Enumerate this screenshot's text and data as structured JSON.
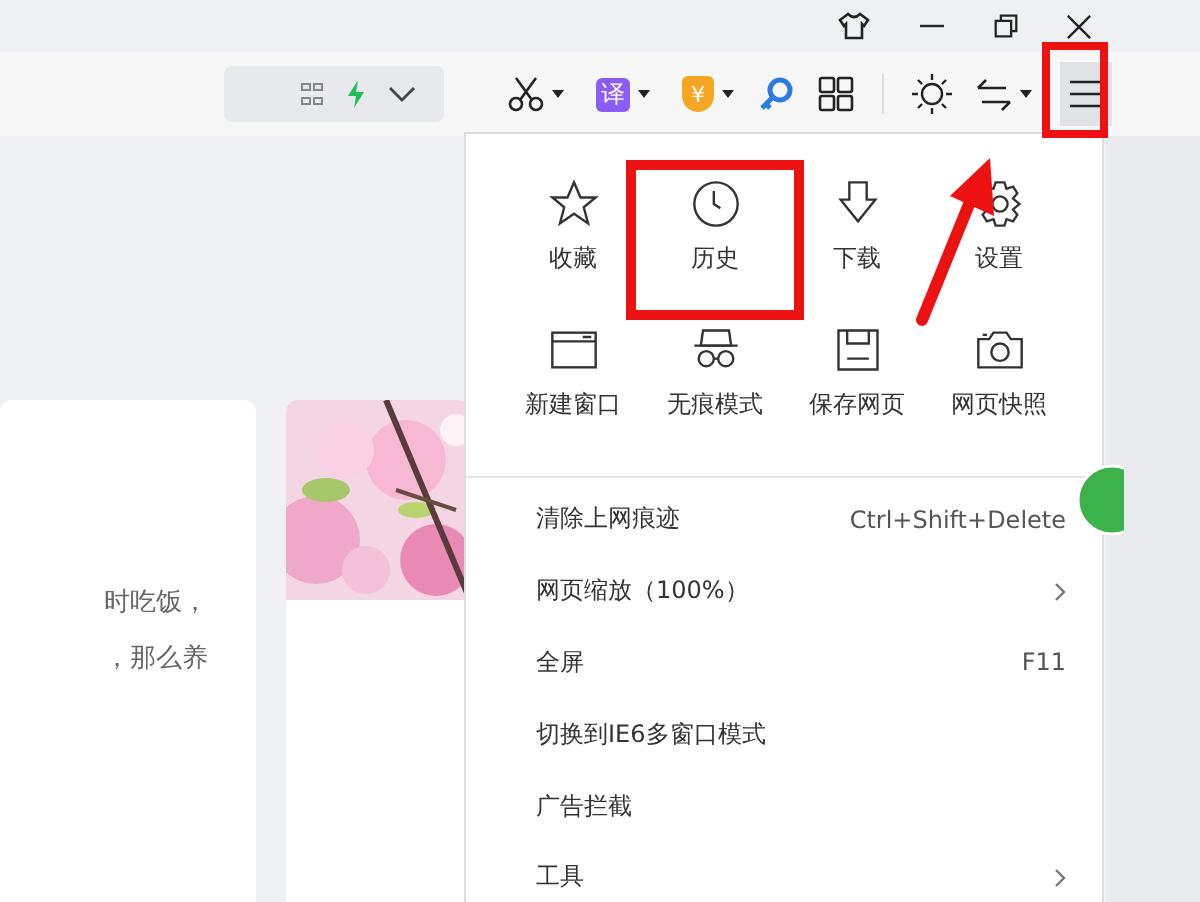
{
  "toolbar": {
    "translate_label": "译",
    "shield_label": "¥",
    "menu_highlighted": true
  },
  "content": {
    "snippets": [
      "时吃饭，",
      "，那么养"
    ]
  },
  "menu": {
    "grid": [
      {
        "label": "收藏",
        "highlighted": false
      },
      {
        "label": "历史",
        "highlighted": true
      },
      {
        "label": "下载",
        "highlighted": false
      },
      {
        "label": "设置",
        "highlighted": false
      },
      {
        "label": "新建窗口",
        "highlighted": false
      },
      {
        "label": "无痕模式",
        "highlighted": false
      },
      {
        "label": "保存网页",
        "highlighted": false
      },
      {
        "label": "网页快照",
        "highlighted": false
      }
    ],
    "items": [
      {
        "label": "清除上网痕迹",
        "shortcut": "Ctrl+Shift+Delete",
        "submenu": false
      },
      {
        "label": "网页缩放（100%）",
        "submenu": true
      },
      {
        "label": "全屏",
        "shortcut": "F11",
        "submenu": false
      },
      {
        "label": "切换到IE6多窗口模式",
        "submenu": false
      },
      {
        "label": "广告拦截",
        "submenu": false
      },
      {
        "label": "工具",
        "submenu": true
      }
    ]
  },
  "annotation_arrow": true
}
